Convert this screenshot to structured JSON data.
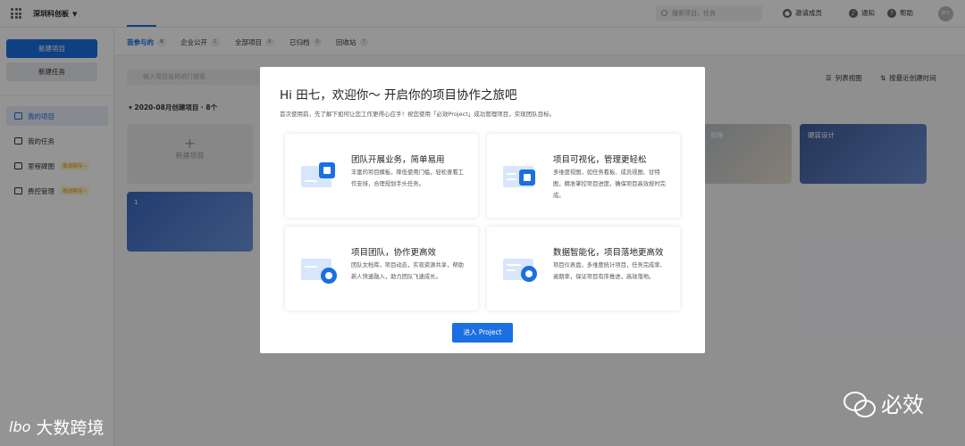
{
  "topbar": {
    "workspace": "深圳科创板",
    "search_placeholder": "搜索项目、任务",
    "invite_label": "邀请成员",
    "notify_label": "通知",
    "help_label": "帮助",
    "avatar_text": "田七"
  },
  "sidebar": {
    "new_project": "新建项目",
    "new_task": "新建任务",
    "items": [
      {
        "label": "我的项目",
        "badge": ""
      },
      {
        "label": "我的任务",
        "badge": ""
      },
      {
        "label": "里程碑图",
        "badge": "敬请期待~"
      },
      {
        "label": "费控管理",
        "badge": "敬请期待~"
      }
    ]
  },
  "tabs": [
    {
      "label": "我参与的",
      "count": "8"
    },
    {
      "label": "企业公开",
      "count": "1"
    },
    {
      "label": "全部项目",
      "count": "8"
    },
    {
      "label": "已归档",
      "count": "0"
    },
    {
      "label": "回收站",
      "count": "7"
    }
  ],
  "main": {
    "filter_placeholder": "输入项目名称进行搜索",
    "group_title": "2020-08月创建项目 · 8个",
    "new_project_card": "新建项目",
    "card1_title": "1",
    "card_photo_title": "管理",
    "card_dark_title": "硬装设计",
    "list_view": "列表视图",
    "sort_label": "按最近创建时间"
  },
  "modal": {
    "title": "Hi 田七，欢迎你～ 开启你的项目协作之旅吧",
    "subtitle": "首次使用前，先了解下如何让您工作更得心应手！祝您使用「必效Project」成功管理项目，实现团队目标。",
    "features": [
      {
        "title": "团队开展业务，简单易用",
        "desc": "丰富的项目模板，降低使用门槛，轻松查看工作安排，合理规划手头任务。",
        "icon": "template-icon"
      },
      {
        "title": "项目可视化，管理更轻松",
        "desc": "多维度视图，如任务看板、成员视图、甘特图，精准掌控项目进度，确保项目高效按时完成。",
        "icon": "chat-icon"
      },
      {
        "title": "项目团队，协作更高效",
        "desc": "团队文档库，项目动态，实现资源共享，帮助新人快速融入，助力团队飞速成长。",
        "icon": "pie-icon"
      },
      {
        "title": "数据智能化，项目落地更高效",
        "desc": "项目仪表盘，多维度统计项目，任务完成率、逾期率，保证项目有序推进，高效落地。",
        "icon": "eye-icon"
      }
    ],
    "enter_button": "进入 Project"
  },
  "watermarks": {
    "left": "大数跨境",
    "left_logo": "lbo",
    "right": "必效"
  },
  "colors": {
    "primary": "#1b6fe0",
    "overlay": "rgba(0,0,0,0.42)"
  }
}
